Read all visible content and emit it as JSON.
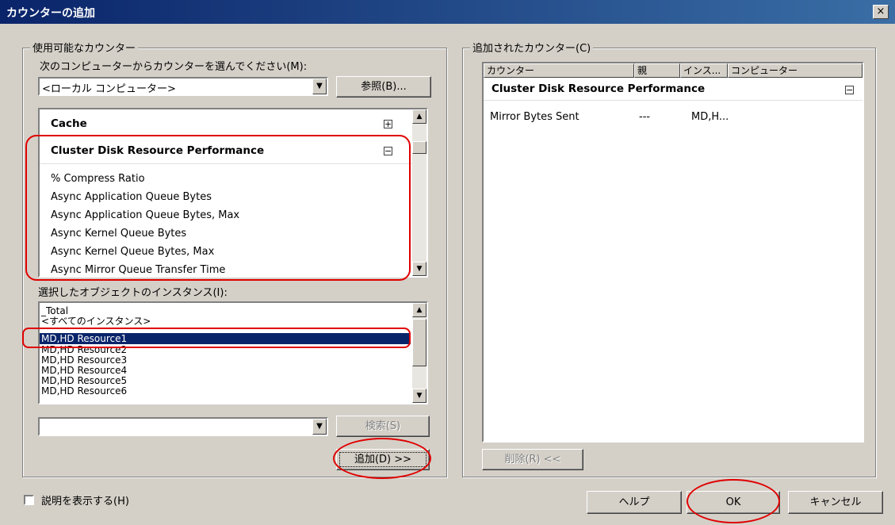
{
  "window": {
    "title": "カウンターの追加",
    "close_label": "×"
  },
  "available": {
    "legend": "使用可能なカウンター",
    "computer_label": "次のコンピューターからカウンターを選んでください(M):",
    "computer_value": "<ローカル コンピューター>",
    "browse_button": "参照(B)...",
    "objects": [
      {
        "name": "Cache",
        "toggle": "+"
      },
      {
        "name": "Cluster Disk Resource Performance",
        "toggle": "−"
      }
    ],
    "counters": [
      "% Compress Ratio",
      "Async Application Queue Bytes",
      "Async Application Queue Bytes, Max",
      "Async Kernel Queue Bytes",
      "Async Kernel Queue Bytes, Max",
      "Async Mirror Queue Transfer Time"
    ],
    "instances_label": "選択したオブジェクトのインスタンス(I):",
    "instances": [
      "_Total",
      "<すべてのインスタンス>",
      "MD,HD Resource1",
      "MD,HD Resource2",
      "MD,HD Resource3",
      "MD,HD Resource4",
      "MD,HD Resource5",
      "MD,HD Resource6"
    ],
    "selected_instance": "MD,HD Resource1",
    "search_value": "",
    "search_button": "検索(S)",
    "add_button": "追加(D) >>"
  },
  "added": {
    "legend": "追加されたカウンター(C)",
    "columns": [
      "カウンター",
      "親",
      "インス...",
      "コンピューター"
    ],
    "group": "Cluster Disk Resource Performance",
    "group_toggle": "−",
    "row": {
      "counter": "Mirror Bytes Sent",
      "parent": "---",
      "instance": "MD,H...",
      "computer": ""
    },
    "remove_button": "削除(R) <<"
  },
  "show_description_label": "説明を表示する(H)",
  "help_button": "ヘルプ",
  "ok_button": "OK",
  "cancel_button": "キャンセル"
}
